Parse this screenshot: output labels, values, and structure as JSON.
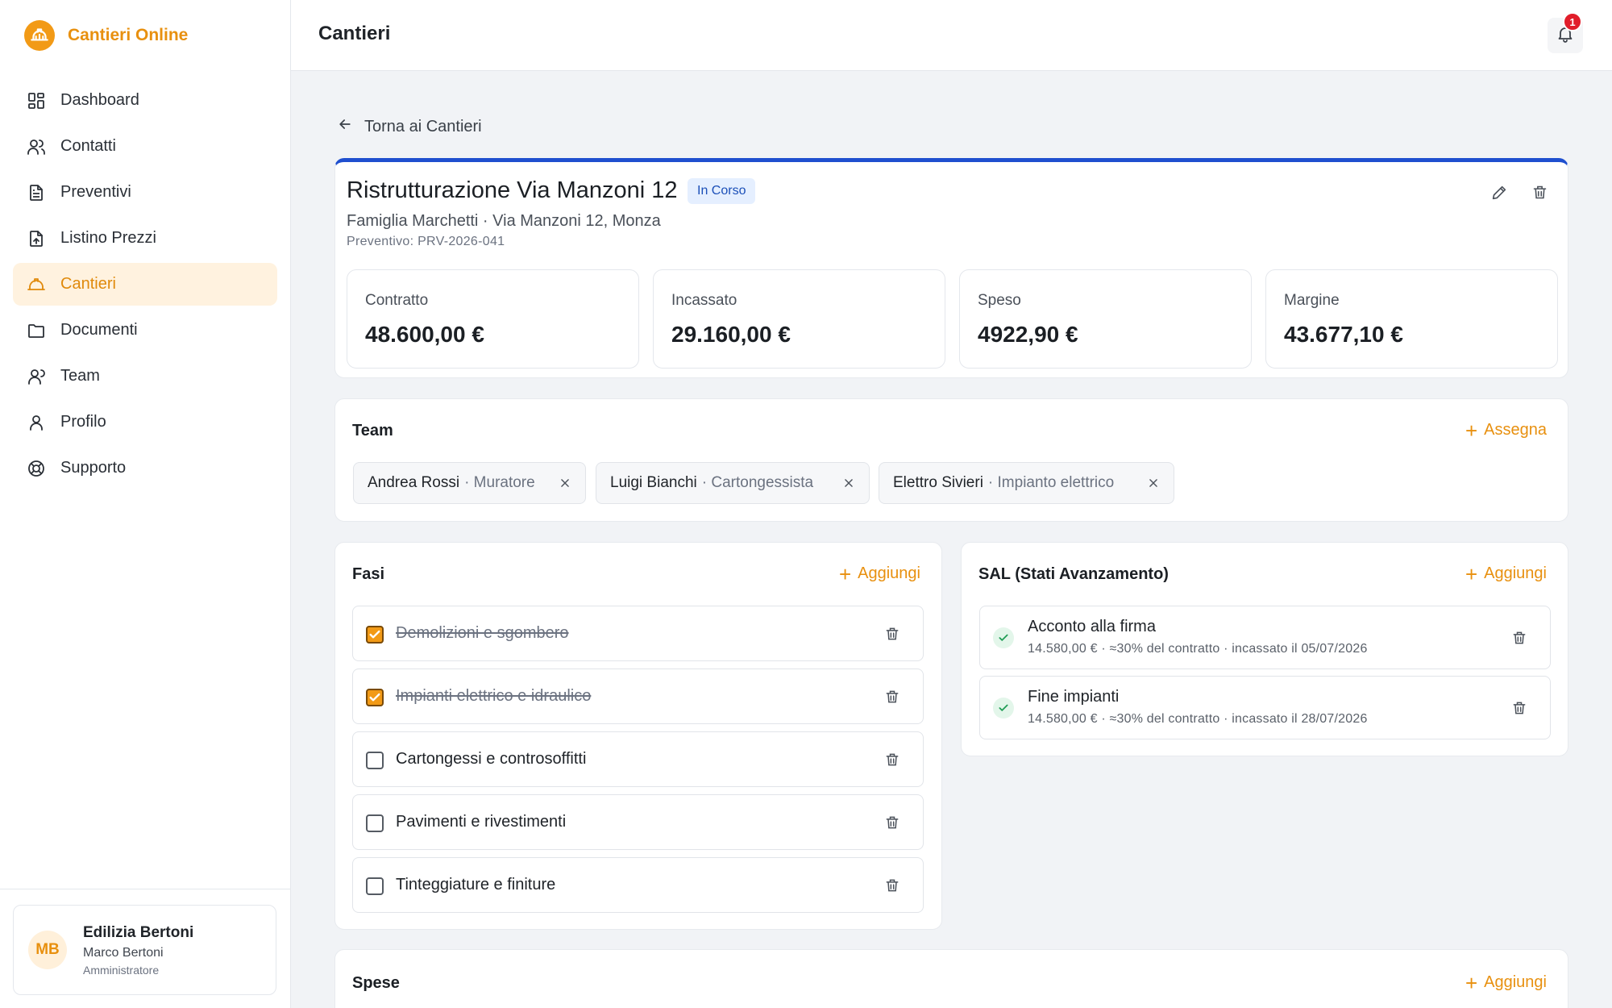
{
  "app": {
    "name": "Cantieri Online"
  },
  "sidebar": {
    "items": [
      {
        "label": "Dashboard",
        "icon": "dashboard-icon"
      },
      {
        "label": "Contatti",
        "icon": "users-icon"
      },
      {
        "label": "Preventivi",
        "icon": "document-icon"
      },
      {
        "label": "Listino Prezzi",
        "icon": "file-upload-icon"
      },
      {
        "label": "Cantieri",
        "icon": "hardhat-icon",
        "active": true
      },
      {
        "label": "Documenti",
        "icon": "folder-icon"
      },
      {
        "label": "Team",
        "icon": "team-icon"
      },
      {
        "label": "Profilo",
        "icon": "user-icon"
      },
      {
        "label": "Supporto",
        "icon": "lifebuoy-icon"
      }
    ],
    "user": {
      "initials": "MB",
      "company": "Edilizia Bertoni",
      "name": "Marco Bertoni",
      "role": "Amministratore"
    }
  },
  "header": {
    "title": "Cantieri",
    "notifications": "1"
  },
  "back_label": "Torna ai Cantieri",
  "project": {
    "title": "Ristrutturazione Via Manzoni 12",
    "status": "In Corso",
    "client": "Famiglia Marchetti · Via Manzoni 12, Monza",
    "quote": "Preventivo: PRV-2026-041",
    "stats": [
      {
        "label": "Contratto",
        "value": "48.600,00 €"
      },
      {
        "label": "Incassato",
        "value": "29.160,00 €"
      },
      {
        "label": "Speso",
        "value": "4922,90 €"
      },
      {
        "label": "Margine",
        "value": "43.677,10 €"
      }
    ]
  },
  "team": {
    "title": "Team",
    "add_label": "Assegna",
    "members": [
      {
        "name": "Andrea Rossi",
        "role": "· Muratore"
      },
      {
        "name": "Luigi Bianchi",
        "role": "· Cartongessista"
      },
      {
        "name": "Elettro Sivieri",
        "role": "· Impianto elettrico"
      }
    ]
  },
  "fasi": {
    "title": "Fasi",
    "add_label": "Aggiungi",
    "items": [
      {
        "label": "Demolizioni e sgombero",
        "done": true
      },
      {
        "label": "Impianti elettrico e idraulico",
        "done": true
      },
      {
        "label": "Cartongessi e controsoffitti",
        "done": false
      },
      {
        "label": "Pavimenti e rivestimenti",
        "done": false
      },
      {
        "label": "Tinteggiature e finiture",
        "done": false
      }
    ]
  },
  "sal": {
    "title": "SAL (Stati Avanzamento)",
    "add_label": "Aggiungi",
    "items": [
      {
        "title": "Acconto alla firma",
        "detail": "14.580,00 € · ≈30% del contratto · incassato il 05/07/2026"
      },
      {
        "title": "Fine impianti",
        "detail": "14.580,00 € · ≈30% del contratto · incassato il 28/07/2026"
      }
    ]
  },
  "spese": {
    "title": "Spese",
    "add_label": "Aggiungi"
  },
  "colors": {
    "accent": "#e8900f",
    "primary_blue": "#1f4fcf",
    "badge_red": "#e11d2a"
  }
}
